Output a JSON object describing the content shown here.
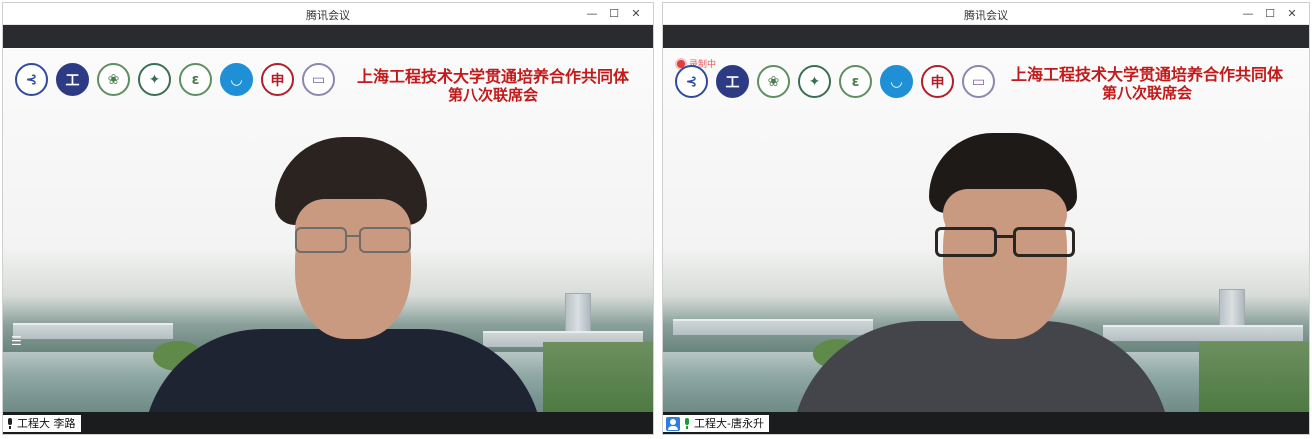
{
  "windows": [
    {
      "title": "腾讯会议",
      "controls": {
        "minimize": "—",
        "maximize": "☐",
        "close": "✕"
      },
      "banner": {
        "line1": "上海工程技术大学贯通培养合作共同体",
        "line2": "第八次联席会"
      },
      "participant": {
        "name": "工程大 李路"
      },
      "logos": [
        "logo-1",
        "logo-2",
        "logo-3",
        "logo-4",
        "logo-5",
        "logo-6",
        "logo-7",
        "logo-8"
      ]
    },
    {
      "title": "腾讯会议",
      "controls": {
        "minimize": "—",
        "maximize": "☐",
        "close": "✕"
      },
      "banner": {
        "line1": "上海工程技术大学贯通培养合作共同体",
        "line2": "第八次联席会"
      },
      "participant": {
        "name": "工程大-唐永升"
      },
      "recording": {
        "label": "录制中"
      },
      "logos": [
        "logo-1",
        "logo-2",
        "logo-3",
        "logo-4",
        "logo-5",
        "logo-6",
        "logo-7",
        "logo-8"
      ]
    }
  ],
  "colors": {
    "banner_red": "#c21a1a",
    "topbar": "#2a2b2e",
    "bottombar": "#1b1c1e",
    "mic_green": "#1a9b3a",
    "badge_blue": "#2f7de0"
  },
  "icons": [
    "minimize-icon",
    "maximize-icon",
    "close-icon",
    "microphone-icon",
    "participant-icon",
    "menu-icon",
    "record-icon"
  ]
}
